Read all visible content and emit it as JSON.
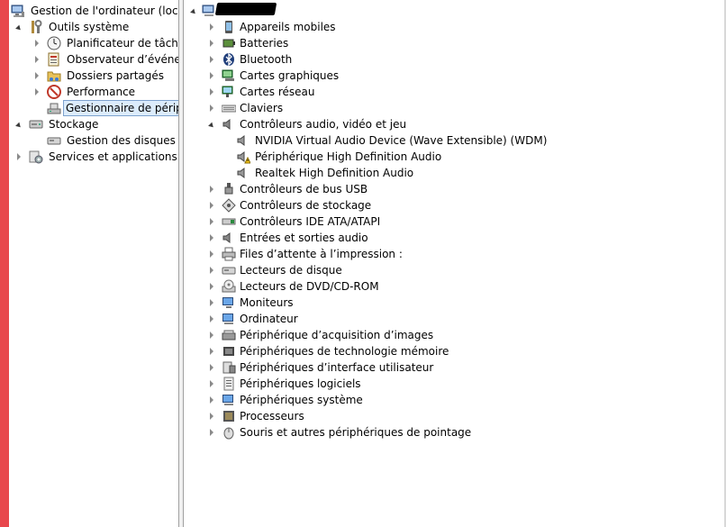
{
  "left_tree": {
    "root": "Gestion de l'ordinateur (local)",
    "outils": "Outils système",
    "planificateur": "Planificateur de tâches",
    "observateur": "Observateur d’événeme",
    "dossiers": "Dossiers partagés",
    "performance": "Performance",
    "gestionnaire": "Gestionnaire de périphé",
    "stockage": "Stockage",
    "disques": "Gestion des disques",
    "services": "Services et applications"
  },
  "device_tree": {
    "categories": [
      "Appareils mobiles",
      "Batteries",
      "Bluetooth",
      "Cartes graphiques",
      "Cartes réseau",
      "Claviers",
      "Contrôleurs audio, vidéo et jeu",
      "Contrôleurs de bus USB",
      "Contrôleurs de stockage",
      "Contrôleurs IDE ATA/ATAPI",
      "Entrées et sorties audio",
      "Files d’attente à l’impression :",
      "Lecteurs de disque",
      "Lecteurs de DVD/CD-ROM",
      "Moniteurs",
      "Ordinateur",
      "Périphérique d’acquisition d’images",
      "Périphériques de technologie mémoire",
      "Périphériques d’interface utilisateur",
      "Périphériques logiciels",
      "Périphériques système",
      "Processeurs",
      "Souris et autres périphériques de pointage"
    ],
    "audio_children": [
      "NVIDIA Virtual Audio Device (Wave Extensible) (WDM)",
      "Périphérique High Definition Audio",
      "Realtek High Definition Audio"
    ]
  }
}
